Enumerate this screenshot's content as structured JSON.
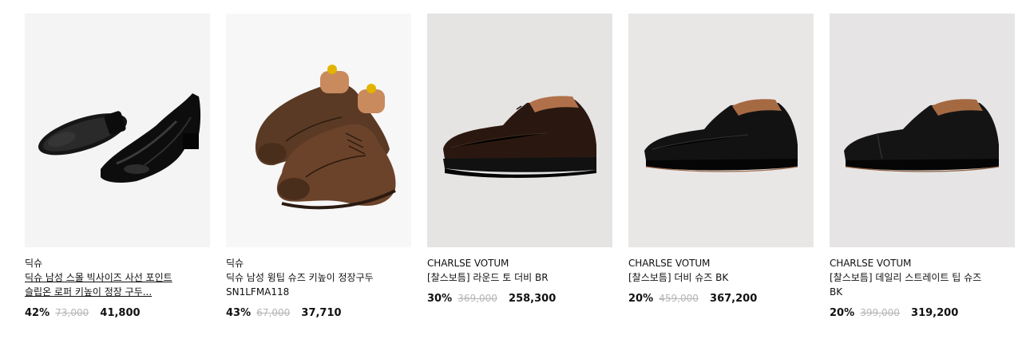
{
  "products": [
    {
      "brand": "딕슈",
      "title": "딕슈 남성 스몰 빅사이즈 사선 포인트 슬립온 로퍼 키높이 정장 구두...",
      "discount": "42%",
      "original_price": "73,000",
      "sale_price": "41,800",
      "image": "black-slip-on-loafer-image",
      "bg_color": "#f4f4f4"
    },
    {
      "brand": "딕슈",
      "title": "딕슈 남성 윙팁 슈즈 키높이 정장구두 SN1LFMA118",
      "discount": "43%",
      "original_price": "67,000",
      "sale_price": "37,710",
      "image": "brown-wingtip-shoes-image",
      "bg_color": "#f7f7f7"
    },
    {
      "brand": "CHARLSE VOTUM",
      "title": "[찰스보틈] 라운드 토 더비 BR",
      "discount": "30%",
      "original_price": "369,000",
      "sale_price": "258,300",
      "image": "dark-brown-derby-image",
      "bg_color": "#e6e3e3"
    },
    {
      "brand": "CHARLSE VOTUM",
      "title": "[찰스보틈] 더비 슈즈 BK",
      "discount": "20%",
      "original_price": "459,000",
      "sale_price": "367,200",
      "image": "black-derby-image",
      "bg_color": "#e9e6e6"
    },
    {
      "brand": "CHARLSE VOTUM",
      "title": "[찰스보틈] 데일리 스트레이트 팁 슈즈 BK",
      "discount": "20%",
      "original_price": "399,000",
      "sale_price": "319,200",
      "image": "black-straight-tip-image",
      "bg_color": "#e6e4e4"
    }
  ]
}
